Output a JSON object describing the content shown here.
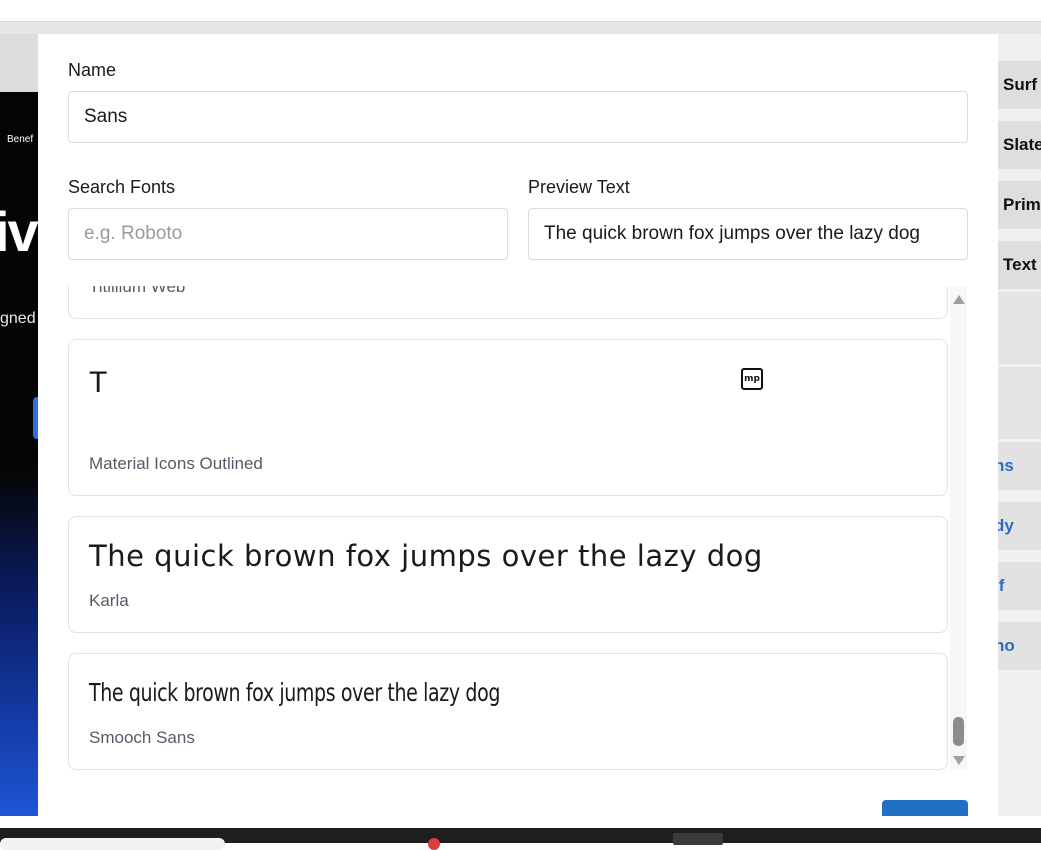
{
  "form": {
    "name_label": "Name",
    "name_value": "Sans",
    "search_label": "Search Fonts",
    "search_placeholder": "e.g. Roboto",
    "preview_label": "Preview Text",
    "preview_value": "The quick brown fox jumps over the lazy dog"
  },
  "font_list": {
    "partial_item": "Titillium Web",
    "items": [
      {
        "preview": "T",
        "name": "Material Icons Outlined",
        "icon": "mp-icon"
      },
      {
        "preview": "The quick brown fox jumps over the lazy dog",
        "name": "Karla"
      },
      {
        "preview": "The quick brown fox jumps over the lazy dog",
        "name": "Smooch Sans"
      }
    ]
  },
  "background": {
    "left": {
      "nav_text": "Benef",
      "hero_text": "iv",
      "subtitle": "gned"
    },
    "right": {
      "items": [
        "Surf",
        "Slate",
        "Prim",
        "Text"
      ],
      "links": [
        "ns",
        "dy",
        "if",
        "no"
      ]
    }
  },
  "colors": {
    "accent": "#1f6fc5",
    "link": "#2a6ec4"
  }
}
